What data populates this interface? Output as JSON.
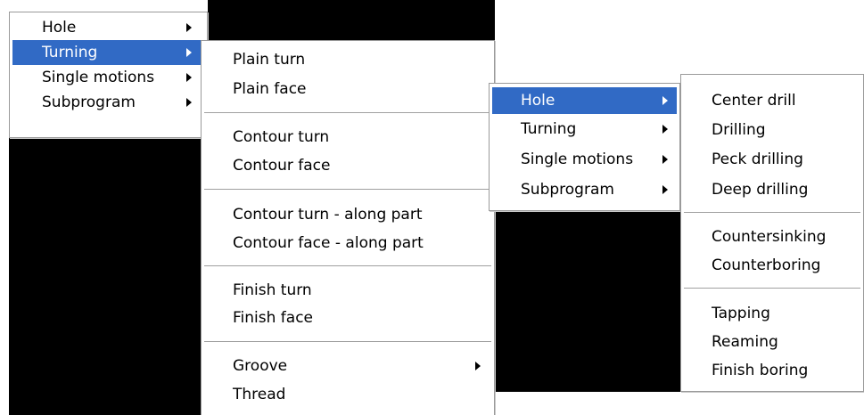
{
  "menu_left": {
    "items": [
      {
        "label": "Hole",
        "has_submenu": true,
        "selected": false
      },
      {
        "label": "Turning",
        "has_submenu": true,
        "selected": true
      },
      {
        "label": "Single motions",
        "has_submenu": true,
        "selected": false
      },
      {
        "label": "Subprogram",
        "has_submenu": true,
        "selected": false
      }
    ]
  },
  "turning_submenu": {
    "items": [
      {
        "label": "Plain turn"
      },
      {
        "label": "Plain face"
      },
      {
        "label": "Contour turn"
      },
      {
        "label": "Contour face"
      },
      {
        "label": "Contour turn - along part"
      },
      {
        "label": "Contour face - along part"
      },
      {
        "label": "Finish turn"
      },
      {
        "label": "Finish face"
      },
      {
        "label": "Groove",
        "has_submenu": true
      },
      {
        "label": "Thread"
      }
    ]
  },
  "menu_right": {
    "items": [
      {
        "label": "Hole",
        "has_submenu": true,
        "selected": true
      },
      {
        "label": "Turning",
        "has_submenu": true,
        "selected": false
      },
      {
        "label": "Single motions",
        "has_submenu": true,
        "selected": false
      },
      {
        "label": "Subprogram",
        "has_submenu": true,
        "selected": false
      }
    ]
  },
  "hole_submenu": {
    "items": [
      {
        "label": "Center drill"
      },
      {
        "label": "Drilling"
      },
      {
        "label": "Peck drilling"
      },
      {
        "label": "Deep drilling"
      },
      {
        "label": "Countersinking"
      },
      {
        "label": "Counterboring"
      },
      {
        "label": "Tapping"
      },
      {
        "label": "Reaming"
      },
      {
        "label": "Finish boring"
      }
    ]
  },
  "colors": {
    "selection": "#316ac5",
    "background_black": "#000000",
    "menu_background": "#ffffff"
  }
}
